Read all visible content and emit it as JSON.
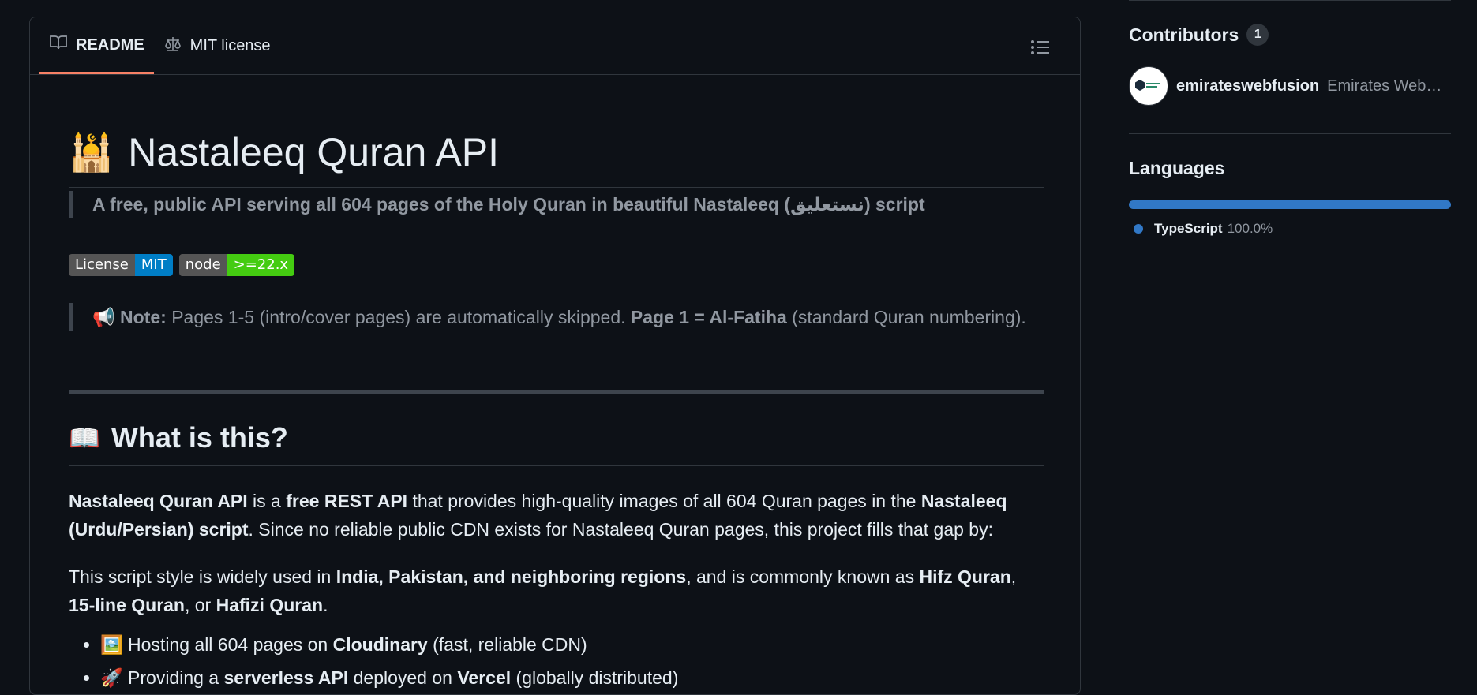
{
  "tabs": [
    {
      "label": "README",
      "icon": "book-icon",
      "active": true
    },
    {
      "label": "MIT license",
      "icon": "law-scale-icon",
      "active": false
    }
  ],
  "readme": {
    "title_emoji": "🕌",
    "title": "Nastaleeq Quran API",
    "tagline": "A free, public API serving all 604 pages of the Holy Quran in beautiful Nastaleeq (نستعلیق) script",
    "badges": [
      {
        "left": "License",
        "right": "MIT",
        "color": "#007ec6"
      },
      {
        "left": "node",
        "right": ">=22.x",
        "color": "#4c1"
      }
    ],
    "note": {
      "emoji": "📢",
      "label": "Note:",
      "text1": " Pages 1-5 (intro/cover pages) are automatically skipped. ",
      "bold": "Page 1 = Al-Fatiha",
      "text2": " (standard Quran numbering)."
    },
    "section": {
      "emoji": "📖",
      "heading": "What is this?"
    },
    "p1": {
      "b1": "Nastaleeq Quran API",
      "t1": " is a ",
      "b2": "free REST API",
      "t2": " that provides high-quality images of all 604 Quran pages in the ",
      "b3": "Nastaleeq (Urdu/Persian) script",
      "t3": ". Since no reliable public CDN exists for Nastaleeq Quran pages, this project fills that gap by:"
    },
    "p2": {
      "t1": "This script style is widely used in ",
      "b1": "India, Pakistan, and neighboring regions",
      "t2": ", and is commonly known as ",
      "b2": "Hifz Quran",
      "t3": ", ",
      "b3": "15-line Quran",
      "t4": ", or ",
      "b4": "Hafizi Quran",
      "t5": "."
    },
    "bullets": [
      {
        "emoji": "🖼️",
        "t1": " Hosting all 604 pages on ",
        "b": "Cloudinary",
        "t2": " (fast, reliable CDN)"
      },
      {
        "emoji": "🚀",
        "t1": " Providing a ",
        "b": "serverless API",
        "t2": " deployed on ",
        "b2": "Vercel",
        "t3": " (globally distributed)"
      }
    ]
  },
  "sidebar": {
    "contributors": {
      "heading": "Contributors",
      "count": "1",
      "items": [
        {
          "login": "emirateswebfusion",
          "name": "Emirates WebFusion"
        }
      ]
    },
    "languages": {
      "heading": "Languages",
      "items": [
        {
          "name": "TypeScript",
          "percent": "100.0%",
          "color": "#3178c6"
        }
      ]
    }
  }
}
